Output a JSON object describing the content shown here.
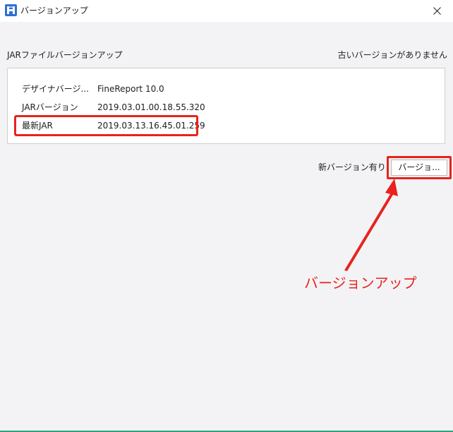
{
  "window": {
    "title": "バージョンアップ",
    "icon": "fine-report-app-icon",
    "close_icon": "close-icon"
  },
  "header": {
    "section_label": "JARファイルバージョンアップ",
    "status": "古いバージョンがありません"
  },
  "info": {
    "rows": [
      {
        "label": "デザイナバージ...",
        "value": "FineReport 10.0"
      },
      {
        "label": "JARバージョン",
        "value": "2019.03.01.00.18.55.320"
      },
      {
        "label": "最新JAR",
        "value": "2019.03.13.16.45.01.259"
      }
    ]
  },
  "update": {
    "label": "新バージョン有り",
    "button_label": "バージョ..."
  },
  "callout": {
    "text": "バージョンアップ",
    "color": "#e8231d"
  },
  "colors": {
    "accent": "#e8231d",
    "background": "#f3f3f5",
    "bottom_bar": "#2aa57d"
  }
}
